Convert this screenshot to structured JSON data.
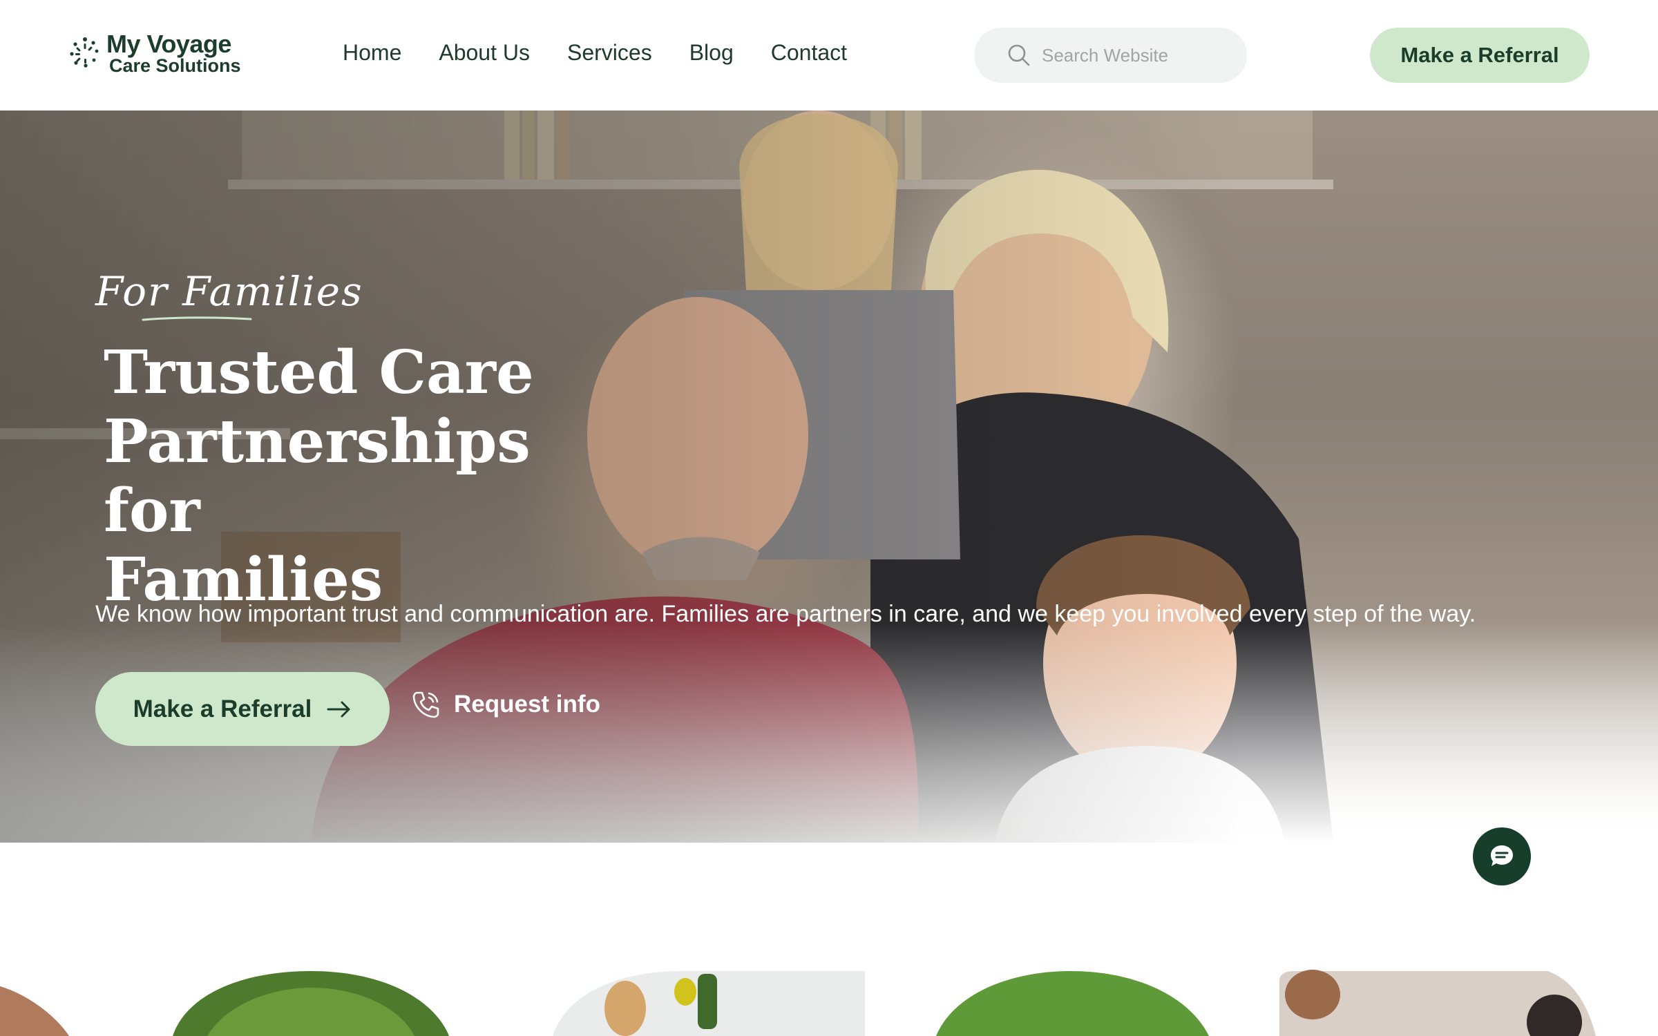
{
  "header": {
    "logo": {
      "line1": "My Voyage",
      "line2": "Care Solutions",
      "icon": "sunburst-icon"
    },
    "nav": [
      {
        "label": "Home"
      },
      {
        "label": "About Us"
      },
      {
        "label": "Services"
      },
      {
        "label": "Blog"
      },
      {
        "label": "Contact"
      }
    ],
    "search": {
      "placeholder": "Search Website",
      "icon": "search-icon"
    },
    "cta_label": "Make a Referral"
  },
  "hero": {
    "eyebrow": "For Families",
    "title_lines": [
      "Trusted Care",
      "Partnerships for",
      "Families"
    ],
    "text": "We know how important trust and communication are. Families are partners in care, and we keep you involved every step of the way.",
    "primary_cta": "Make a Referral",
    "secondary_cta": "Request info"
  },
  "chat": {
    "icon": "chat-bubble-icon"
  },
  "colors": {
    "brand_dark": "#1b3d2a",
    "accent_light": "#cfe8cc",
    "chat_bg": "#173d2b",
    "search_bg": "#f1f3f2"
  }
}
